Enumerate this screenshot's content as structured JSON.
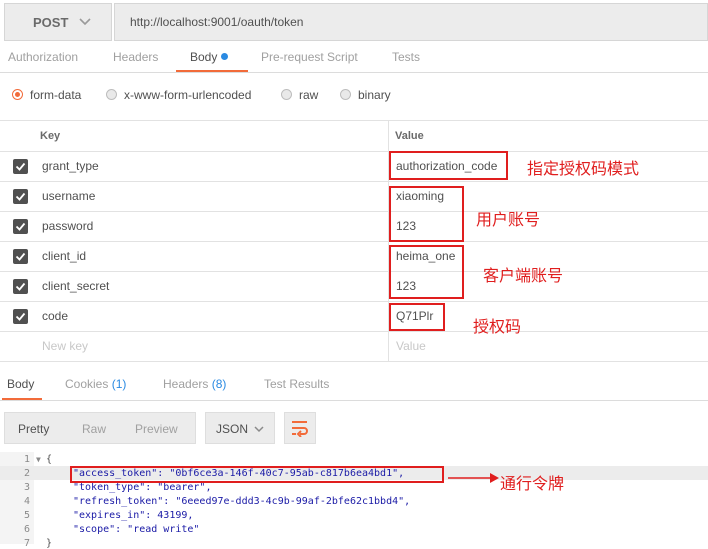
{
  "request": {
    "method": "POST",
    "url": "http://localhost:9001/oauth/token"
  },
  "request_tabs": [
    "Authorization",
    "Headers",
    "Body",
    "Pre-request Script",
    "Tests"
  ],
  "body_types": [
    "form-data",
    "x-www-form-urlencoded",
    "raw",
    "binary"
  ],
  "params": {
    "key_header": "Key",
    "value_header": "Value",
    "rows": [
      {
        "key": "grant_type",
        "value": "authorization_code",
        "checked": true
      },
      {
        "key": "username",
        "value": "xiaoming",
        "checked": true
      },
      {
        "key": "password",
        "value": "123",
        "checked": true
      },
      {
        "key": "client_id",
        "value": "heima_one",
        "checked": true
      },
      {
        "key": "client_secret",
        "value": "123",
        "checked": true
      },
      {
        "key": "code",
        "value": "Q71Plr",
        "checked": true
      }
    ],
    "new_key_placeholder": "New key",
    "new_value_placeholder": "Value"
  },
  "annotations": {
    "grant": "指定授权码模式",
    "user": "用户账号",
    "client": "客户端账号",
    "code": "授权码",
    "token": "通行令牌"
  },
  "response_tabs": {
    "body": "Body",
    "cookies": "Cookies",
    "cookies_count": "(1)",
    "headers": "Headers",
    "headers_count": "(8)",
    "tests": "Test Results"
  },
  "view_modes": [
    "Pretty",
    "Raw",
    "Preview"
  ],
  "format": "JSON",
  "code_lines": [
    {
      "n": "1",
      "text": "{"
    },
    {
      "n": "2",
      "text": "\"access_token\": \"0bf6ce3a-146f-40c7-95ab-c817b6ea4bd1\","
    },
    {
      "n": "3",
      "text": "\"token_type\": \"bearer\","
    },
    {
      "n": "4",
      "text": "\"refresh_token\": \"6eeed97e-ddd3-4c9b-99af-2bfe62c1bbd4\","
    },
    {
      "n": "5",
      "text": "\"expires_in\": 43199,"
    },
    {
      "n": "6",
      "text": "\"scope\": \"read write\""
    },
    {
      "n": "7",
      "text": "}"
    }
  ],
  "colors": {
    "accent": "#f26b3a",
    "link": "#2a8ae2",
    "annotation": "#e01e1e"
  }
}
